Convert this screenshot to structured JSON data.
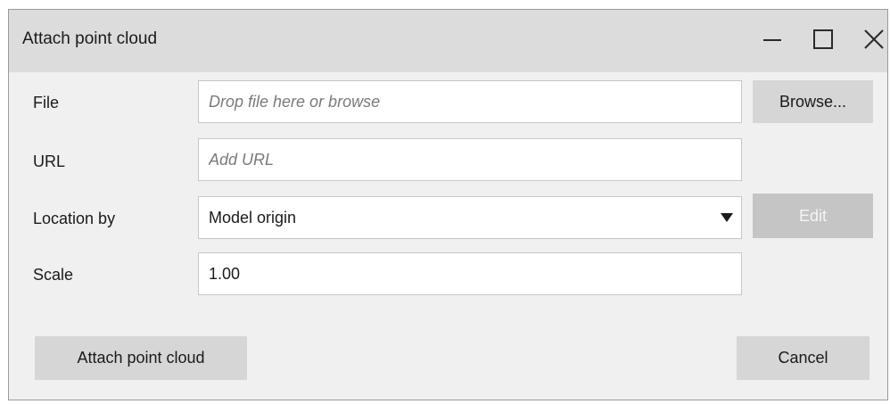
{
  "window": {
    "title": "Attach point cloud",
    "controls": [
      "minimize-icon",
      "maximize-icon",
      "close-icon"
    ]
  },
  "form": {
    "file": {
      "label": "File",
      "placeholder": "Drop file here or browse",
      "value": "",
      "browse_label": "Browse..."
    },
    "url": {
      "label": "URL",
      "placeholder": "Add URL",
      "value": ""
    },
    "location": {
      "label": "Location by",
      "selected": "Model origin",
      "edit_label": "Edit",
      "edit_enabled": false
    },
    "scale": {
      "label": "Scale",
      "value": "1.00"
    }
  },
  "footer": {
    "attach_label": "Attach point cloud",
    "cancel_label": "Cancel"
  }
}
